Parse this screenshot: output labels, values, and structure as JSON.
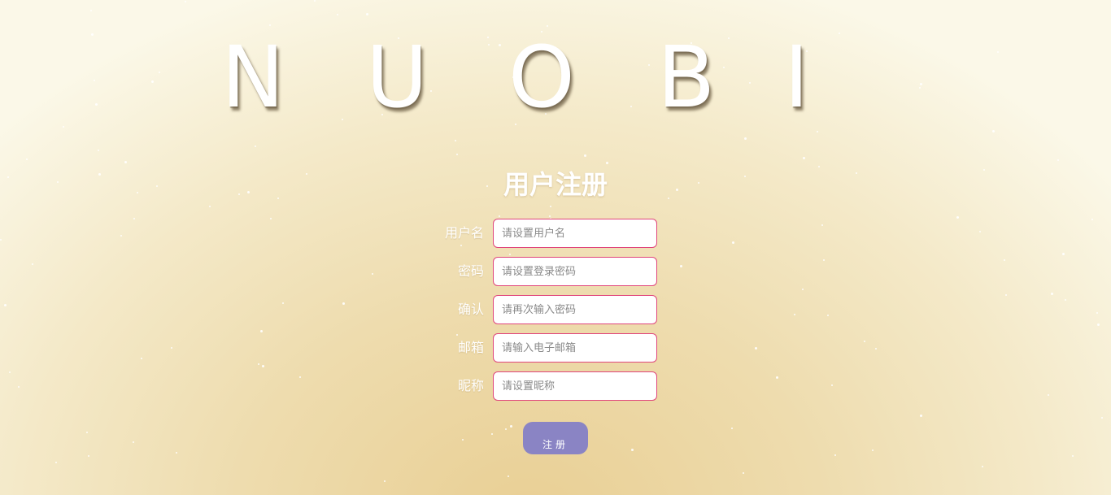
{
  "brand": {
    "letters": [
      "N",
      "U",
      "O",
      "B",
      "I"
    ]
  },
  "form": {
    "title": "用户注册",
    "fields": [
      {
        "label": "用户名",
        "placeholder": "请设置用户名",
        "value": ""
      },
      {
        "label": "密码",
        "placeholder": "请设置登录密码",
        "value": ""
      },
      {
        "label": "确认",
        "placeholder": "请再次输入密码",
        "value": ""
      },
      {
        "label": "邮箱",
        "placeholder": "请输入电子邮箱",
        "value": ""
      },
      {
        "label": "昵称",
        "placeholder": "请设置昵称",
        "value": ""
      }
    ],
    "submit_label": "注册"
  },
  "colors": {
    "input_border": "#e0457b",
    "button_bg": "#8a84c4",
    "text": "#ffffff"
  }
}
